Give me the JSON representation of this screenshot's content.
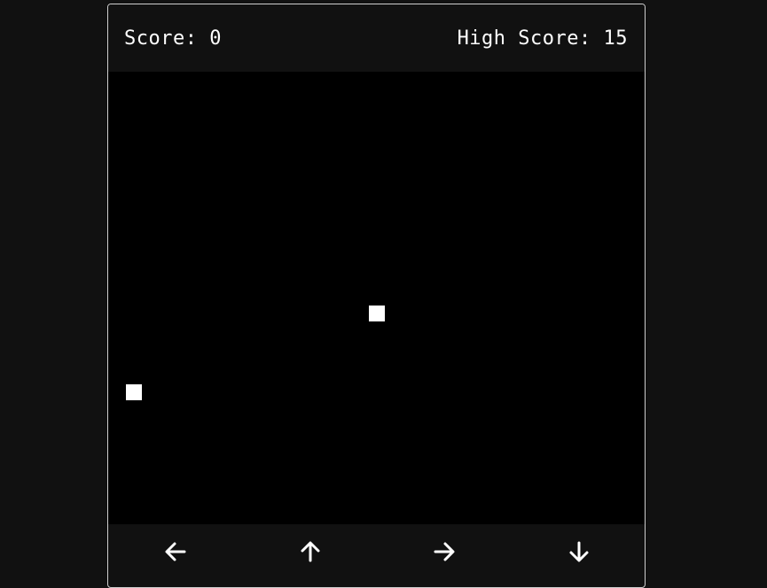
{
  "header": {
    "score_label": "Score: 0",
    "high_score_label": "High Score: 15"
  },
  "game": {
    "score": 0,
    "high_score": 15,
    "colors": {
      "background": "#111111",
      "board": "#000000",
      "pieces": "#ffffff"
    }
  },
  "controls": [
    {
      "direction": "left",
      "icon": "arrow-left-icon"
    },
    {
      "direction": "up",
      "icon": "arrow-up-icon"
    },
    {
      "direction": "right",
      "icon": "arrow-right-icon"
    },
    {
      "direction": "down",
      "icon": "arrow-down-icon"
    }
  ]
}
